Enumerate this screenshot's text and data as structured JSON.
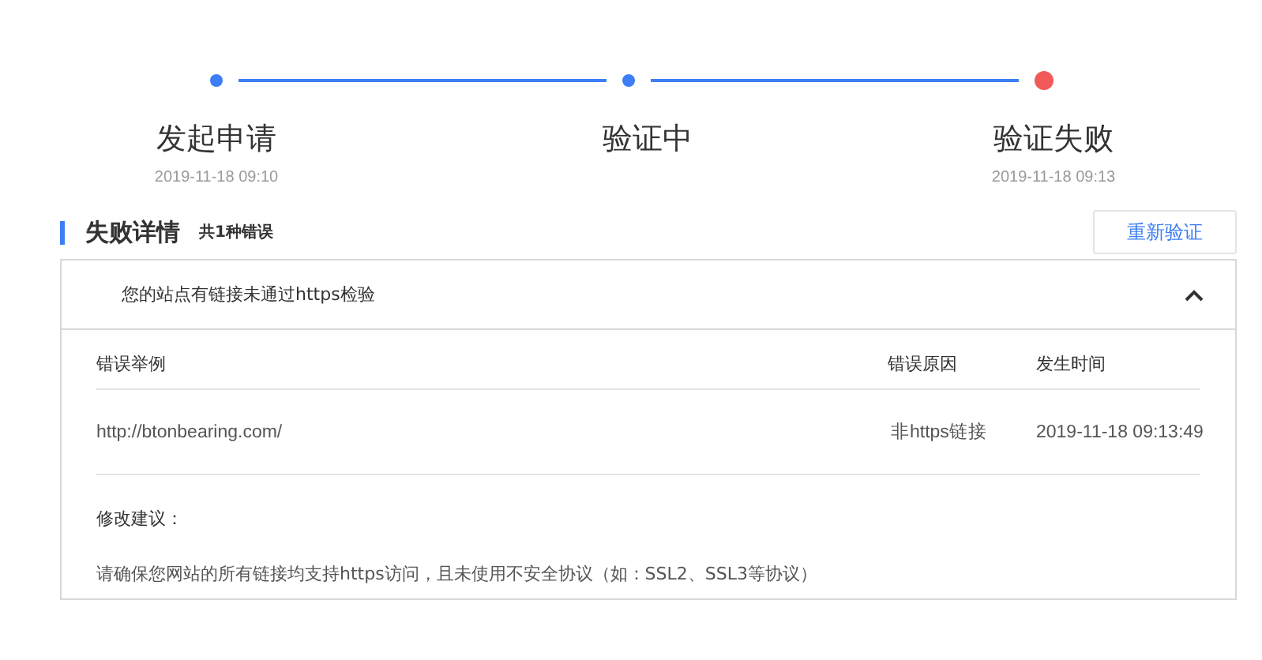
{
  "steps": [
    {
      "title": "发起申请",
      "date": "2019-11-18 09:10",
      "failed": false
    },
    {
      "title": "验证中",
      "failed": false
    },
    {
      "title": "验证失败",
      "date": "2019-11-18 09:13",
      "failed": true
    }
  ],
  "section": {
    "title": "失败详情",
    "count": "共1种错误",
    "button": "重新验证"
  },
  "panel": {
    "title": "您的站点有链接未通过https检验",
    "expanded": true,
    "columns": [
      "错误举例",
      "错误原因",
      "发生时间"
    ],
    "rows": [
      [
        "http://btonbearing.com/",
        "非https链接",
        "2019-11-18 09:13:49"
      ]
    ],
    "advice_title": "修改建议：",
    "advice": "请确保您网站的所有链接均支持https访问，且未使用不安全协议（如：SSL2、SSL3等协议）"
  }
}
